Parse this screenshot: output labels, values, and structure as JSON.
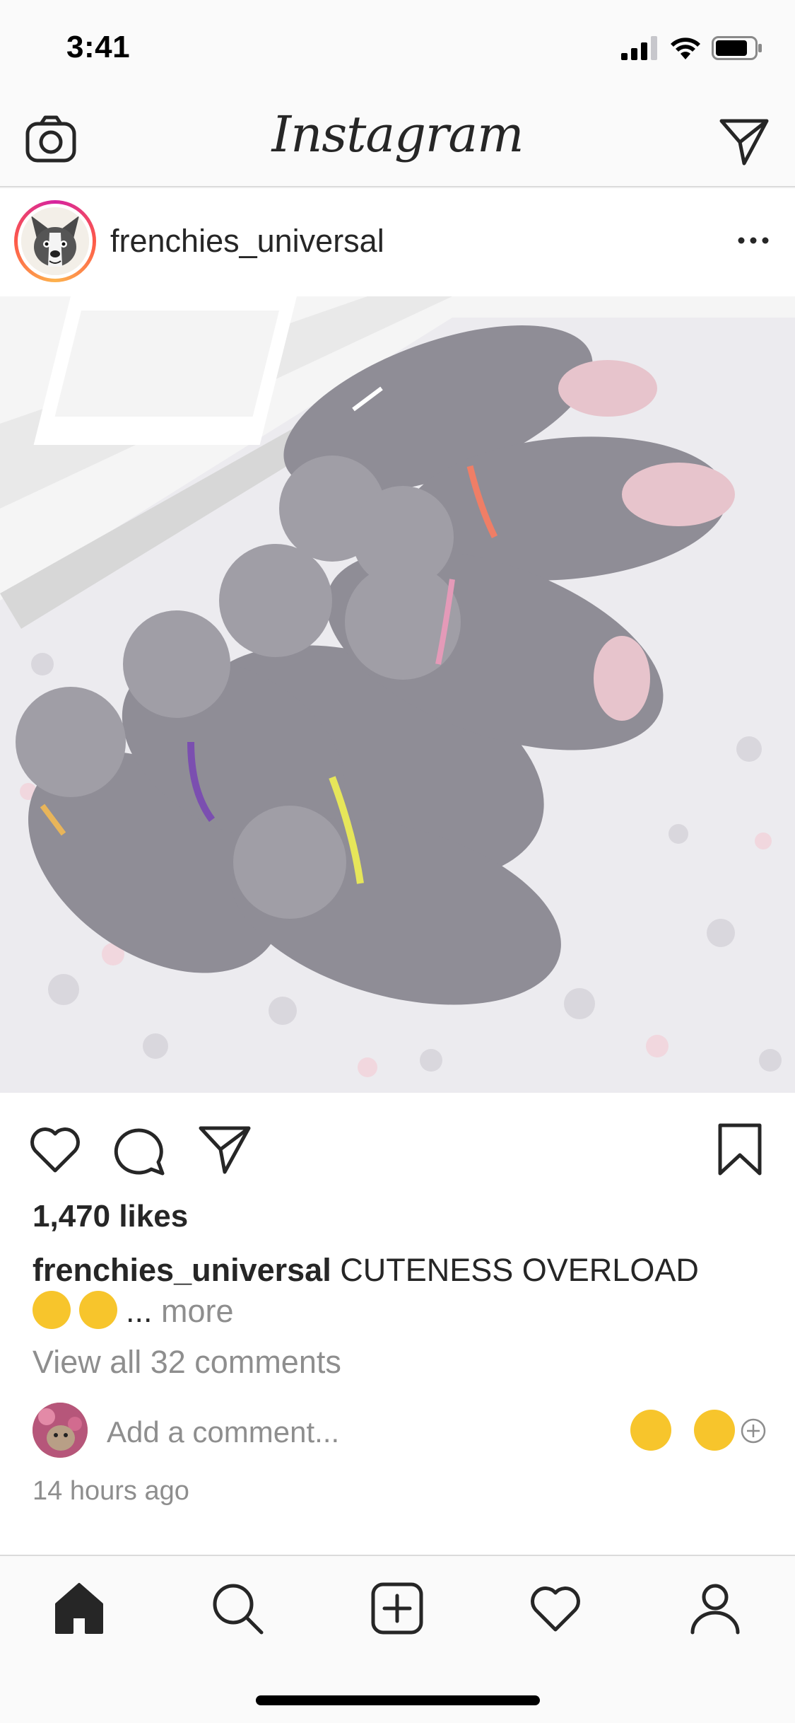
{
  "status_bar": {
    "time": "3:41"
  },
  "nav": {
    "logo": "Instagram"
  },
  "post": {
    "username": "frenchies_universal",
    "likes": "1,470 likes",
    "caption_user": "frenchies_universal",
    "caption_text": "CUTENESS OVERLOAD",
    "caption_ellipsis": "...",
    "more_label": "more",
    "view_comments": "View all 32 comments",
    "comment_placeholder": "Add a comment...",
    "timestamp": "14 hours ago"
  },
  "icons": {
    "camera": "camera-icon",
    "direct": "paper-plane-icon",
    "more": "more-dots-icon",
    "like": "heart-icon",
    "comment": "comment-bubble-icon",
    "share": "paper-plane-icon",
    "save": "bookmark-icon",
    "home": "home-icon",
    "search": "search-icon",
    "add": "add-post-icon",
    "activity": "heart-icon",
    "profile": "profile-icon"
  },
  "colors": {
    "text": "#262626",
    "secondary_text": "#8e8e8e",
    "divider": "#dbdbdb",
    "background": "#fafafa",
    "story_ring_start": "#d6249f",
    "story_ring_end": "#fdb24c"
  }
}
